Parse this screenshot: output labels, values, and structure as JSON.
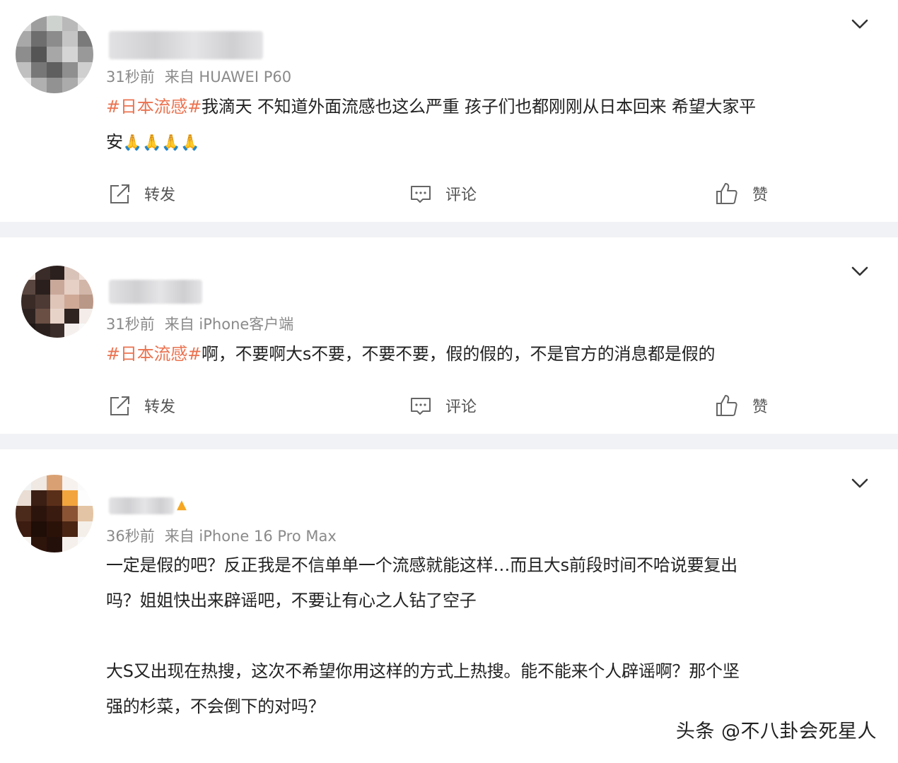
{
  "posts": [
    {
      "meta_time": "31秒前",
      "meta_source": "来自 HUAWEI P60",
      "hashtag": "#日本流感#",
      "line1": "我滴天 不知道外面流感也这么严重 孩子们也都刚刚从日本回来 希望大家平",
      "line2": "安",
      "emojis": "🙏🙏🙏🙏"
    },
    {
      "meta_time": "31秒前",
      "meta_source": "来自 iPhone客户端",
      "hashtag": "#日本流感#",
      "line1": "啊，不要啊大s不要，不要不要，假的假的，不是官方的消息都是假的"
    },
    {
      "meta_time": "36秒前",
      "meta_source": "来自 iPhone 16 Pro Max",
      "line1": "一定是假的吧？反正我是不信单单一个流感就能这样…而且大s前段时间不哈说要复出",
      "line2": "吗？姐姐快出来辟谣吧，不要让有心之人钻了空子",
      "line3": "大S又出现在热搜，这次不希望你用这样的方式上热搜。能不能来个人辟谣啊？那个坚",
      "line4": "强的杉菜，不会倒下的对吗？"
    }
  ],
  "actions": {
    "repost": "转发",
    "comment": "评论",
    "like": "赞"
  },
  "icons": {
    "repost": "repost-icon",
    "comment": "comment-icon",
    "like": "thumbs-up-icon",
    "menu": "chevron-down-icon"
  },
  "colors": {
    "hashtag": "#eb7350",
    "meta": "#8a8a8a",
    "background": "#f1f2f5"
  },
  "watermark": "头条 @不八卦会死星人"
}
